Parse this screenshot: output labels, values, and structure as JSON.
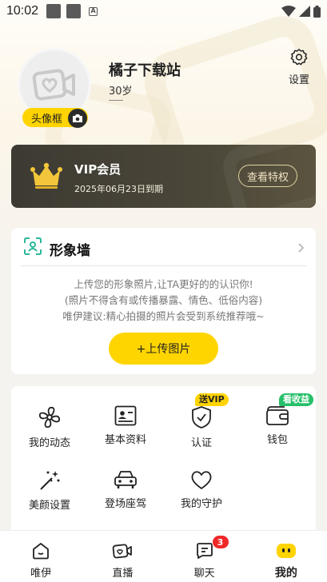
{
  "status_bar": {
    "time": "10:02",
    "notif_icon_label": "A"
  },
  "profile": {
    "avatar_frame_label": "头像框",
    "username": "橘子下载站",
    "age": "30岁",
    "settings_label": "设置"
  },
  "vip": {
    "title": "VIP会员",
    "expire": "2025年06月23日到期",
    "button": "查看特权"
  },
  "image_wall": {
    "title": "形象墙",
    "desc_line1": "上传您的形象照片,让TA更好的的认识你!",
    "desc_line2": "(照片不得含有或传播暴露、情色、低俗内容)",
    "desc_line3": "唯伊建议:精心拍摄的照片会受到系统推荐哦~",
    "upload_button": "+上传图片"
  },
  "features": {
    "items": [
      {
        "label": "我的动态",
        "icon": "fan-icon"
      },
      {
        "label": "基本资料",
        "icon": "id-card-icon"
      },
      {
        "label": "认证",
        "icon": "shield-check-icon"
      },
      {
        "label": "钱包",
        "icon": "wallet-icon"
      },
      {
        "label": "美颜设置",
        "icon": "magic-wand-icon"
      },
      {
        "label": "登场座驾",
        "icon": "car-icon"
      },
      {
        "label": "我的守护",
        "icon": "heart-icon"
      }
    ],
    "tag_vip": "送VIP",
    "tag_earn": "看收益"
  },
  "bottom_nav": {
    "items": [
      {
        "label": "唯伊",
        "icon": "home-icon"
      },
      {
        "label": "直播",
        "icon": "live-icon"
      },
      {
        "label": "聊天",
        "icon": "chat-icon",
        "badge": "3"
      },
      {
        "label": "我的",
        "icon": "me-icon",
        "active": true
      }
    ]
  },
  "colors": {
    "accent": "#ffd400",
    "vip_bg": "#3d3a33",
    "badge_red": "#f02828",
    "earn_green": "#27c06a"
  }
}
